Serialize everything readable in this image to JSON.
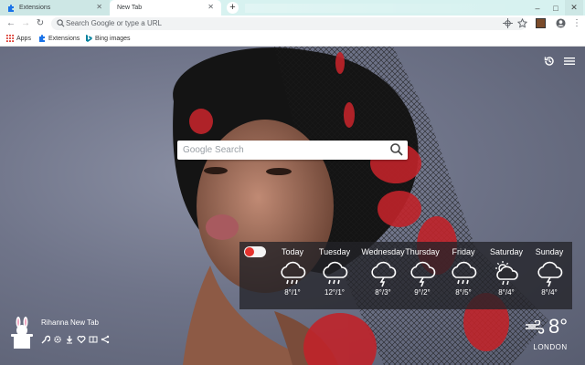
{
  "browser": {
    "tabs": [
      {
        "title": "Extensions",
        "active": false
      },
      {
        "title": "New Tab",
        "active": true
      }
    ],
    "omnibox_placeholder": "Search Google or type a URL",
    "bookmarks": [
      {
        "label": "Apps",
        "icon": "apps-grid-icon"
      },
      {
        "label": "Extensions",
        "icon": "puzzle-icon"
      },
      {
        "label": "Bing images",
        "icon": "bing-icon"
      }
    ]
  },
  "page": {
    "search_placeholder": "Google Search",
    "weather": {
      "days": [
        {
          "name": "Today",
          "icon": "rain-cloud-icon",
          "temp": "8°/1°"
        },
        {
          "name": "Tuesday",
          "icon": "rain-cloud-icon",
          "temp": "12°/1°"
        },
        {
          "name": "Wednesday",
          "icon": "thunder-cloud-icon",
          "temp": "8°/3°"
        },
        {
          "name": "Thursday",
          "icon": "thunder-cloud-icon",
          "temp": "9°/2°"
        },
        {
          "name": "Friday",
          "icon": "rain-cloud-icon",
          "temp": "8°/5°"
        },
        {
          "name": "Saturday",
          "icon": "sun-rain-cloud-icon",
          "temp": "8°/4°"
        },
        {
          "name": "Sunday",
          "icon": "thunder-cloud-icon",
          "temp": "8°/4°"
        }
      ],
      "current": {
        "temp": "8°",
        "city": "LONDON",
        "icon": "wind-icon"
      }
    },
    "extension": {
      "title": "Rihanna New Tab"
    }
  },
  "colors": {
    "toggle_accent": "#e5322d",
    "tab_strip": "#d7f2f0"
  }
}
